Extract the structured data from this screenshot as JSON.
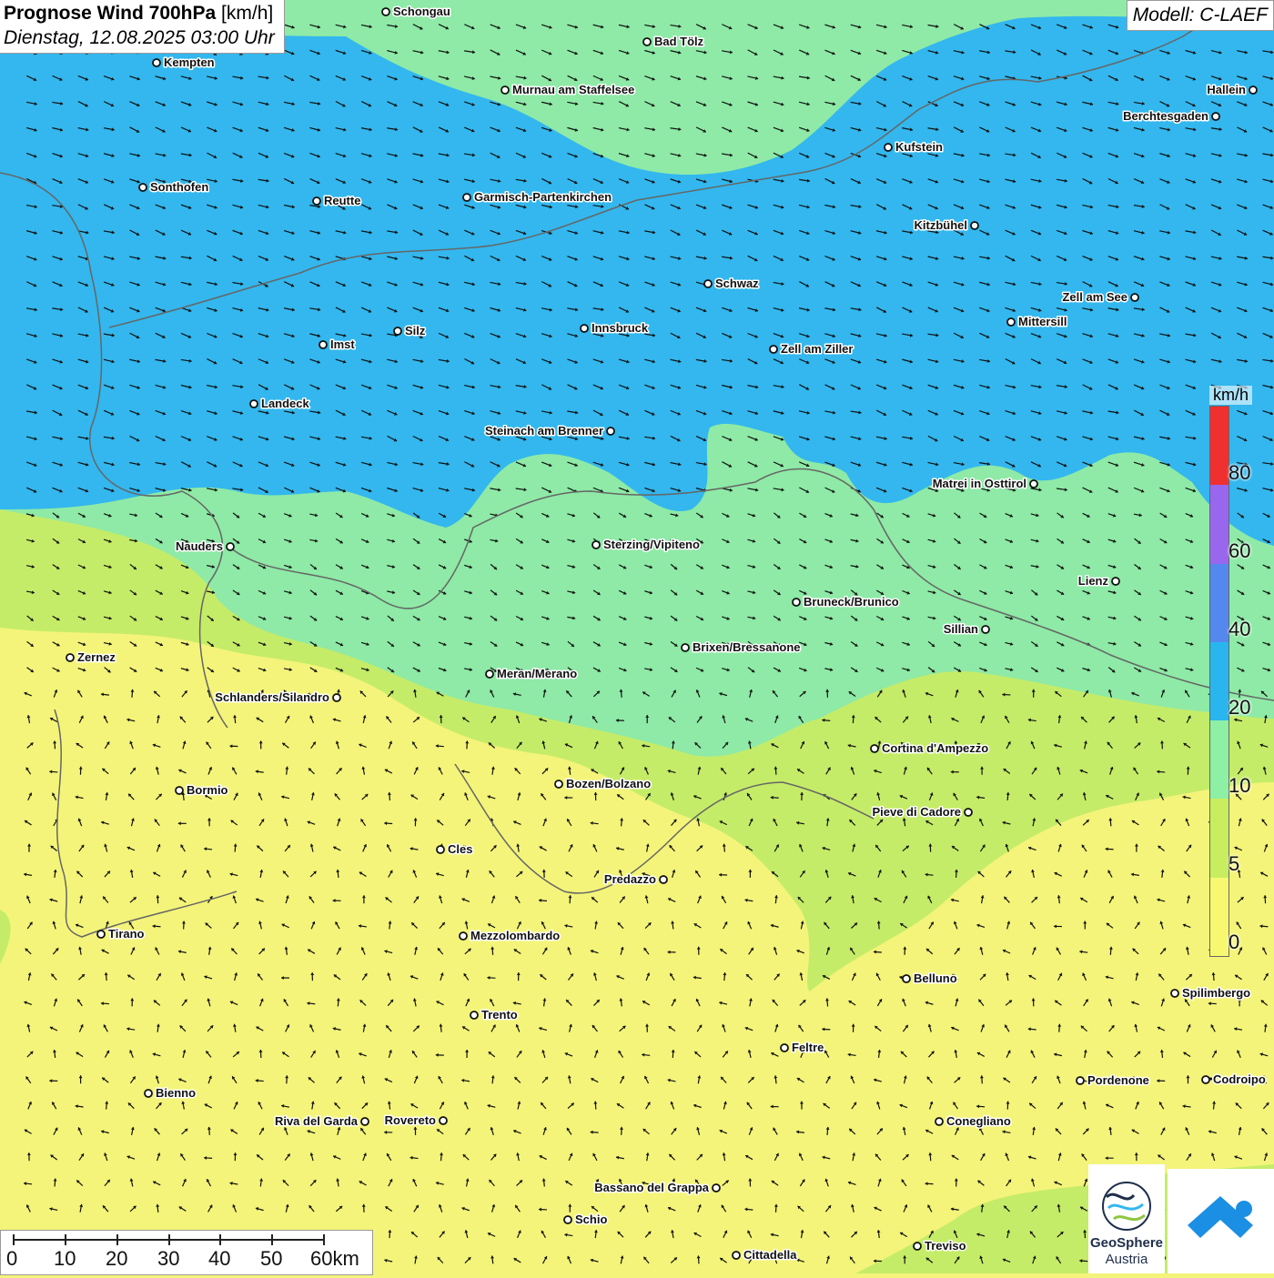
{
  "title": {
    "main": "Prognose Wind 700hPa",
    "unit": "[km/h]",
    "datetime": "Dienstag, 12.08.2025 03:00 Uhr"
  },
  "model": "Modell: C-LAEF",
  "legend": {
    "unit": "km/h",
    "labels": [
      "80",
      "60",
      "40",
      "20",
      "10",
      "5",
      "0"
    ],
    "colors": [
      "#f03030",
      "#9966ee",
      "#5588ee",
      "#29b6ef",
      "#8ef0a4",
      "#c8ee60",
      "#f8f870",
      "#ffffff"
    ]
  },
  "cities": [
    {
      "name": "Schongau"
    },
    {
      "name": "Bad Tölz"
    },
    {
      "name": "Kempten"
    },
    {
      "name": "Murnau am Staffelsee"
    },
    {
      "name": "Hallein"
    },
    {
      "name": "Berchtesgaden"
    },
    {
      "name": "Kufstein"
    },
    {
      "name": "Sonthofen"
    },
    {
      "name": "Reutte"
    },
    {
      "name": "Garmisch-Partenkirchen"
    },
    {
      "name": "Kitzbühel"
    },
    {
      "name": "Schwaz"
    },
    {
      "name": "Zell am See"
    },
    {
      "name": "Mittersill"
    },
    {
      "name": "Innsbruck"
    },
    {
      "name": "Silz"
    },
    {
      "name": "Imst"
    },
    {
      "name": "Zell am Ziller"
    },
    {
      "name": "Landeck"
    },
    {
      "name": "Steinach am Brenner"
    },
    {
      "name": "Matrei in Osttirol"
    },
    {
      "name": "Nauders"
    },
    {
      "name": "Sterzing/Vipiteno"
    },
    {
      "name": "Lienz"
    },
    {
      "name": "Bruneck/Brunico"
    },
    {
      "name": "Sillian"
    },
    {
      "name": "Zernez"
    },
    {
      "name": "Brixen/Bressanone"
    },
    {
      "name": "Meran/Merano"
    },
    {
      "name": "Schlanders/Silandro"
    },
    {
      "name": "Cortina d'Ampezzo"
    },
    {
      "name": "Bozen/Bolzano"
    },
    {
      "name": "Bormio"
    },
    {
      "name": "Pieve di Cadore"
    },
    {
      "name": "Cles"
    },
    {
      "name": "Predazzo"
    },
    {
      "name": "Tirano"
    },
    {
      "name": "Mezzolombardo"
    },
    {
      "name": "Belluno"
    },
    {
      "name": "Spilimbergo"
    },
    {
      "name": "Trento"
    },
    {
      "name": "Feltre"
    },
    {
      "name": "Bienno"
    },
    {
      "name": "Pordenone"
    },
    {
      "name": "Codroipo"
    },
    {
      "name": "Riva del Garda"
    },
    {
      "name": "Rovereto"
    },
    {
      "name": "Conegliano"
    },
    {
      "name": "Bassano del Grappa"
    },
    {
      "name": "Schio"
    },
    {
      "name": "Treviso"
    },
    {
      "name": "Cittadella"
    }
  ],
  "scalebar": {
    "labels": [
      "0",
      "10",
      "20",
      "30",
      "40",
      "50",
      "60km"
    ]
  },
  "logo": {
    "line1": "GeoSphere",
    "line2": "Austria"
  }
}
